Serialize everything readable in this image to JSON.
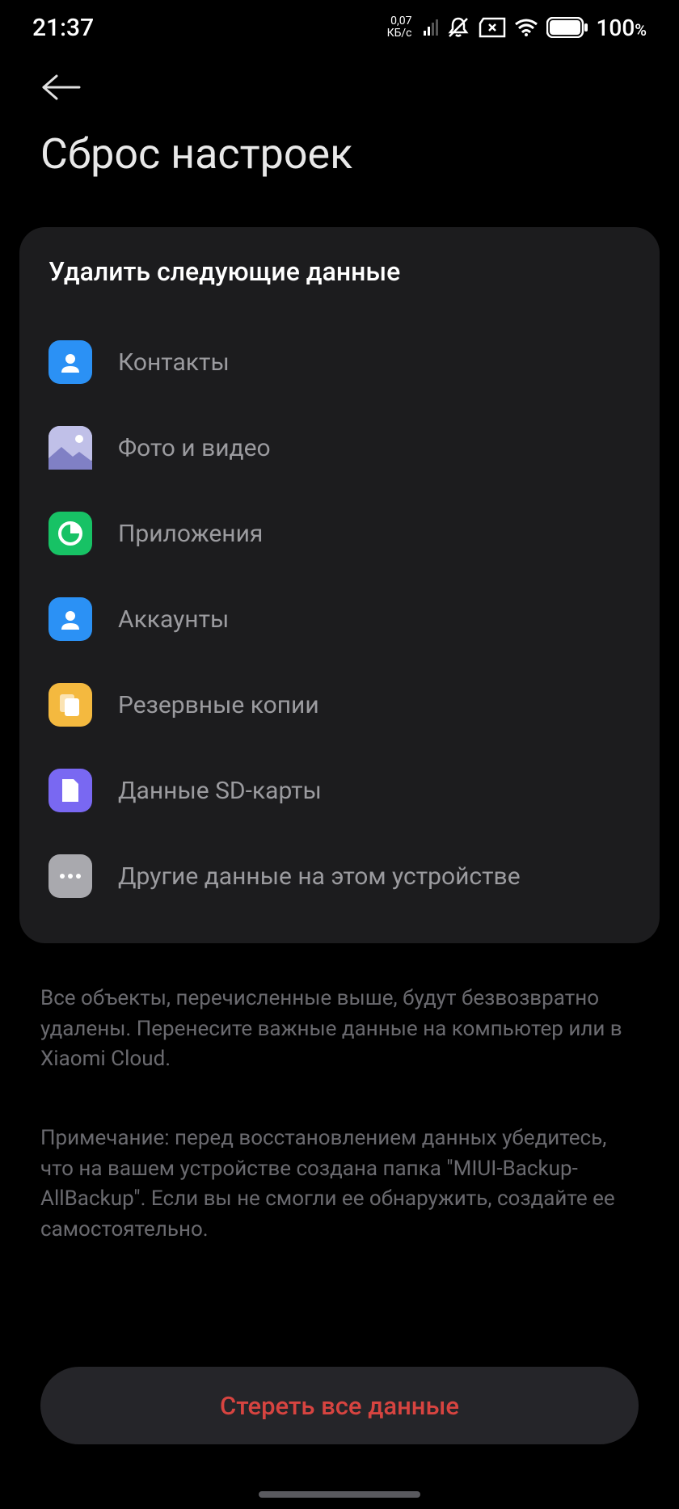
{
  "status_bar": {
    "time": "21:37",
    "data_top": "0,07",
    "data_bottom": "КБ/с",
    "battery_percent": "100",
    "battery_sign": "%"
  },
  "page": {
    "title": "Сброс настроек"
  },
  "card": {
    "title": "Удалить следующие данные",
    "items": [
      {
        "label": "Контакты",
        "icon_class": "icon-contacts",
        "icon_name": "contacts-icon"
      },
      {
        "label": "Фото и видео",
        "icon_class": "icon-photos",
        "icon_name": "photos-icon"
      },
      {
        "label": "Приложения",
        "icon_class": "icon-apps",
        "icon_name": "apps-icon"
      },
      {
        "label": "Аккаунты",
        "icon_class": "icon-accounts",
        "icon_name": "accounts-icon"
      },
      {
        "label": "Резервные копии",
        "icon_class": "icon-backups",
        "icon_name": "backups-icon"
      },
      {
        "label": "Данные SD-карты",
        "icon_class": "icon-sdcard",
        "icon_name": "sdcard-icon"
      },
      {
        "label": "Другие данные на этом устройстве",
        "icon_class": "icon-other",
        "icon_name": "other-icon"
      }
    ]
  },
  "info": {
    "text1": "Все объекты, перечисленные выше, будут безвозвратно удалены. Перенесите важные данные на компьютер или в Xiaomi Cloud.",
    "text2": "Примечание: перед восстановлением данных убедитесь, что на вашем устройстве создана папка \"MIUI-Backup-AllBackup\". Если вы не смогли ее обнаружить, создайте ее самостоятельно."
  },
  "erase_button": {
    "label": "Стереть все данные"
  }
}
